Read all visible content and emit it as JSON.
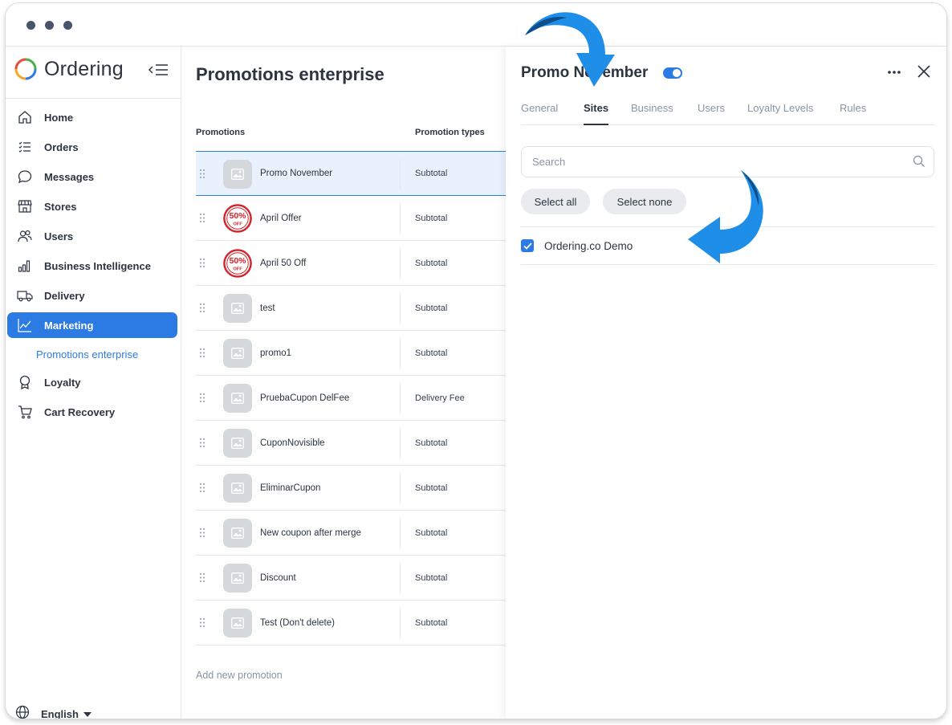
{
  "app": {
    "brand_name": "Ordering"
  },
  "sidebar": {
    "items": [
      {
        "label": "Home",
        "icon": "home-icon"
      },
      {
        "label": "Orders",
        "icon": "orders-icon"
      },
      {
        "label": "Messages",
        "icon": "messages-icon"
      },
      {
        "label": "Stores",
        "icon": "store-icon"
      },
      {
        "label": "Users",
        "icon": "users-icon"
      },
      {
        "label": "Business Intelligence",
        "icon": "bar-chart-icon"
      },
      {
        "label": "Delivery",
        "icon": "truck-icon"
      },
      {
        "label": "Marketing",
        "icon": "trend-icon",
        "active": true
      }
    ],
    "sub_item": "Promotions enterprise",
    "items_after": [
      {
        "label": "Loyalty",
        "icon": "award-icon"
      },
      {
        "label": "Cart Recovery",
        "icon": "cart-icon"
      }
    ],
    "language": "English"
  },
  "main": {
    "title": "Promotions enterprise",
    "columns": [
      "Promotions",
      "Promotion types"
    ],
    "rows": [
      {
        "name": "Promo November",
        "type": "Subtotal",
        "thumb": "placeholder",
        "selected": true
      },
      {
        "name": "April Offer",
        "type": "Subtotal",
        "thumb": "50-off"
      },
      {
        "name": "April 50 Off",
        "type": "Subtotal",
        "thumb": "50-off"
      },
      {
        "name": "test",
        "type": "Subtotal",
        "thumb": "placeholder"
      },
      {
        "name": "promo1",
        "type": "Subtotal",
        "thumb": "placeholder"
      },
      {
        "name": "PruebaCupon DelFee",
        "type": "Delivery Fee",
        "thumb": "placeholder"
      },
      {
        "name": "CuponNovisible",
        "type": "Subtotal",
        "thumb": "placeholder"
      },
      {
        "name": "EliminarCupon",
        "type": "Subtotal",
        "thumb": "placeholder"
      },
      {
        "name": "New coupon after merge",
        "type": "Subtotal",
        "thumb": "placeholder"
      },
      {
        "name": "Discount",
        "type": "Subtotal",
        "thumb": "placeholder"
      },
      {
        "name": "Test (Don't delete)",
        "type": "Subtotal",
        "thumb": "placeholder"
      }
    ],
    "badge_text": {
      "top": "50%",
      "bottom": "OFF"
    },
    "add_label": "Add new promotion"
  },
  "panel": {
    "title": "Promo November",
    "enabled": true,
    "tabs": [
      "General",
      "Sites",
      "Business",
      "Users",
      "Loyalty Levels",
      "Rules"
    ],
    "active_tab": "Sites",
    "search_placeholder": "Search",
    "select_all": "Select all",
    "select_none": "Select none",
    "sites": [
      {
        "name": "Ordering.co Demo",
        "checked": true
      }
    ]
  },
  "colors": {
    "accent": "#2c7be5",
    "arrow": "#1f8ee8",
    "arrow_dark": "#0d4f8c"
  }
}
